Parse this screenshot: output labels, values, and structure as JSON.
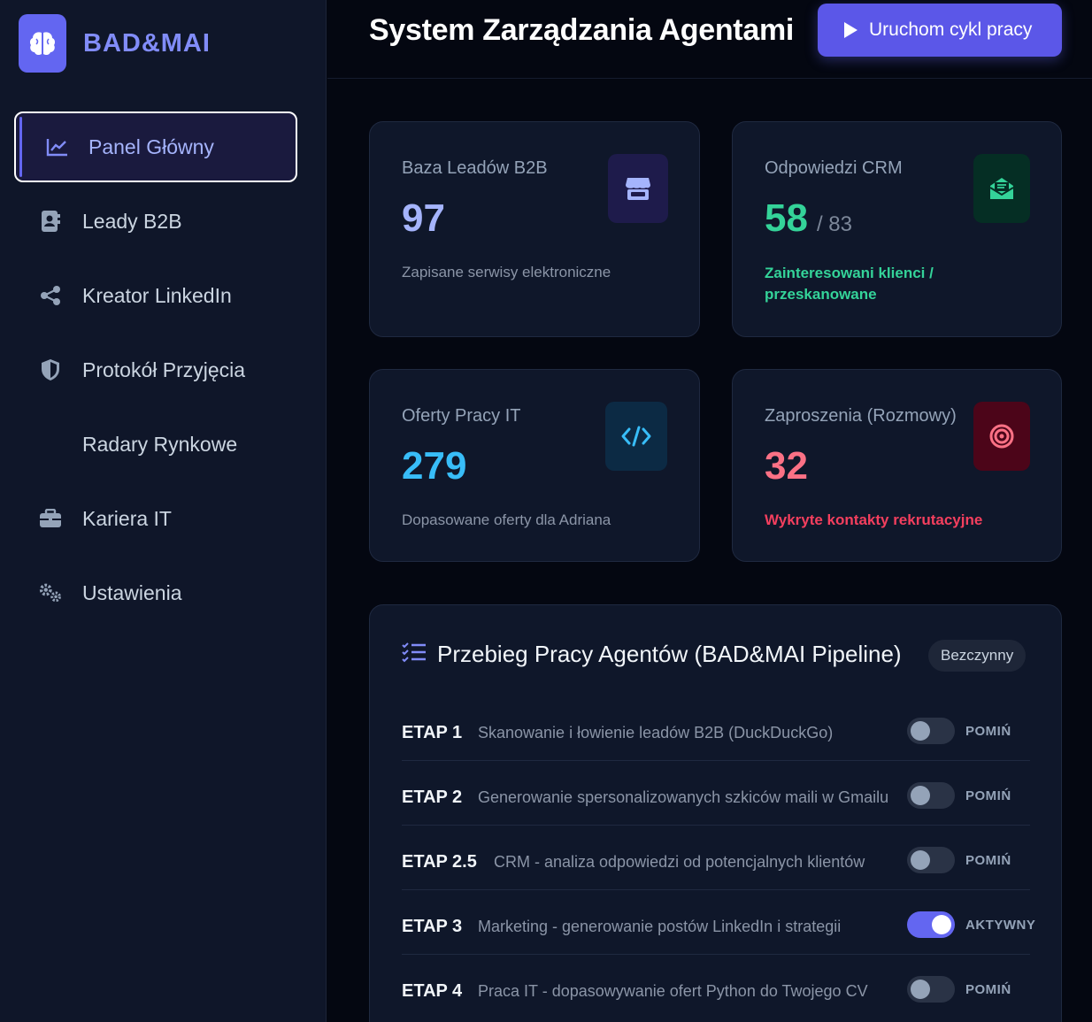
{
  "brand": {
    "name": "BAD&MAI",
    "logo_icon": "brain-icon"
  },
  "sidebar": {
    "items": [
      {
        "label": "Panel Główny",
        "icon": "chart-line-icon",
        "active": true
      },
      {
        "label": "Leady B2B",
        "icon": "address-card-icon"
      },
      {
        "label": "Kreator LinkedIn",
        "icon": "share-nodes-icon"
      },
      {
        "label": "Protokół Przyjęcia",
        "icon": "shield-icon"
      },
      {
        "label": "Radary Rynkowe",
        "icon": ""
      },
      {
        "label": "Kariera IT",
        "icon": "briefcase-icon"
      },
      {
        "label": "Ustawienia",
        "icon": "gears-icon"
      }
    ]
  },
  "header": {
    "title": "System Zarządzania Agentami",
    "run_button": "Uruchom cykl pracy"
  },
  "stats": [
    {
      "label": "Baza Leadów B2B",
      "value": "97",
      "sub": "",
      "desc": "Zapisane serwisy elektroniczne",
      "icon": "store-icon",
      "color": "#a5b4fc"
    },
    {
      "label": "Odpowiedzi CRM",
      "value": "58",
      "sub": "/ 83",
      "desc": "Zainteresowani klienci / przeskanowane",
      "icon": "envelope-open-icon",
      "color": "#34d399"
    },
    {
      "label": "Oferty Pracy IT",
      "value": "279",
      "sub": "",
      "desc": "Dopasowane oferty dla Adriana",
      "icon": "code-icon",
      "color": "#38bdf8"
    },
    {
      "label": "Zaproszenia (Rozmowy)",
      "value": "32",
      "sub": "",
      "desc": "Wykryte kontakty rekrutacyjne",
      "icon": "bullseye-icon",
      "color": "#fb7185"
    }
  ],
  "pipeline": {
    "title": "Przebieg Pracy Agentów (BAD&MAI Pipeline)",
    "status": "Bezczynny",
    "stages": [
      {
        "label": "ETAP 1",
        "desc": "Skanowanie i łowienie leadów B2B (DuckDuckGo)",
        "enabled": false,
        "state": "POMIŃ"
      },
      {
        "label": "ETAP 2",
        "desc": "Generowanie spersonalizowanych szkiców maili w Gmailu",
        "enabled": false,
        "state": "POMIŃ"
      },
      {
        "label": "ETAP 2.5",
        "desc": "CRM - analiza odpowiedzi od potencjalnych klientów",
        "enabled": false,
        "state": "POMIŃ"
      },
      {
        "label": "ETAP 3",
        "desc": "Marketing - generowanie postów LinkedIn i strategii",
        "enabled": true,
        "state": "AKTYWNY"
      },
      {
        "label": "ETAP 4",
        "desc": "Praca IT - dopasowywanie ofert Python do Twojego CV",
        "enabled": false,
        "state": "POMIŃ"
      }
    ]
  }
}
